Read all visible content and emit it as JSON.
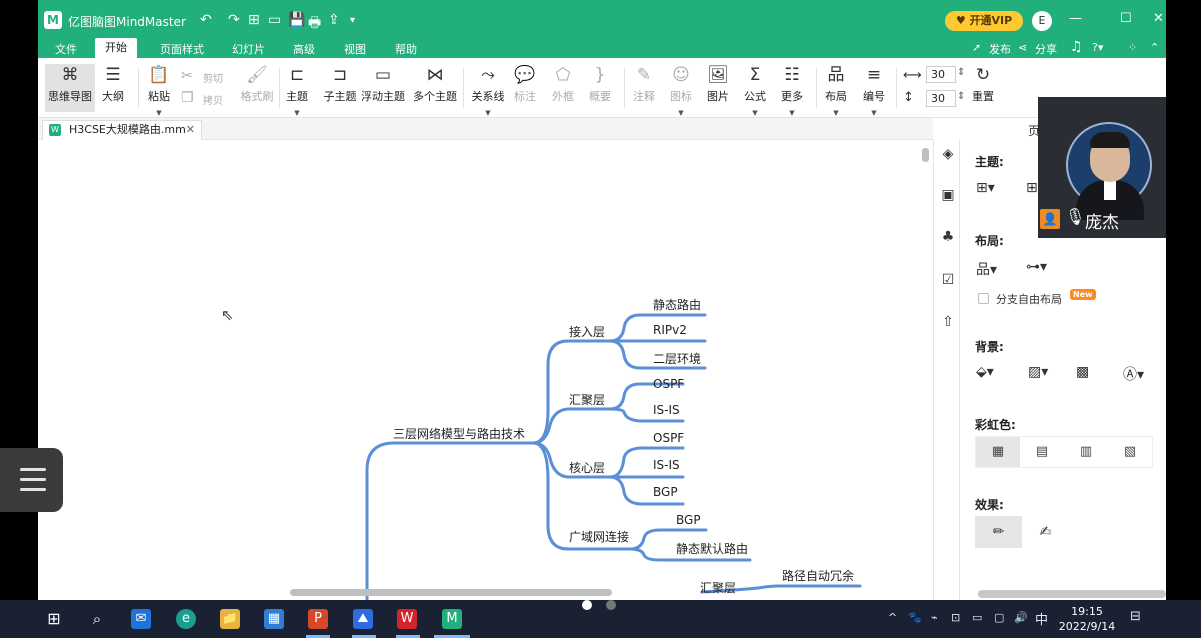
{
  "app": {
    "title": "亿图脑图MindMaster",
    "logo_glyph": "M",
    "vip_label": "开通VIP",
    "user_initial": "E",
    "minimize": "—",
    "maximize": "☐",
    "close": "✕",
    "quick_access": [
      "↶",
      "↷",
      "⊞",
      "▭",
      "💾",
      "🖶",
      "⇪",
      "▾"
    ]
  },
  "menu": {
    "items": [
      "文件",
      "开始",
      "页面样式",
      "幻灯片",
      "高级",
      "视图",
      "帮助"
    ],
    "active": "开始",
    "right": {
      "publish": "发布",
      "share": "分享"
    }
  },
  "ribbon": {
    "buttons": [
      {
        "label": "思维导图",
        "icon": "⌘"
      },
      {
        "label": "大纲",
        "icon": "☰"
      },
      {
        "label": "粘贴",
        "icon": "📋"
      },
      {
        "label": "主题",
        "icon": "⊏"
      },
      {
        "label": "子主题",
        "icon": "⊐"
      },
      {
        "label": "浮动主题",
        "icon": "▭"
      },
      {
        "label": "多个主题",
        "icon": "⋈"
      },
      {
        "label": "关系线",
        "icon": "⤳"
      },
      {
        "label": "标注",
        "icon": "💬"
      },
      {
        "label": "外框",
        "icon": "⬠"
      },
      {
        "label": "概要",
        "icon": "}"
      },
      {
        "label": "注释",
        "icon": "✎"
      },
      {
        "label": "图标",
        "icon": "☺"
      },
      {
        "label": "图片",
        "icon": "🖼"
      },
      {
        "label": "公式",
        "icon": "Σ"
      },
      {
        "label": "更多",
        "icon": "☷"
      },
      {
        "label": "布局",
        "icon": "品"
      },
      {
        "label": "编号",
        "icon": "≡"
      },
      {
        "label": "重置",
        "icon": "↻"
      }
    ],
    "small": {
      "cut": "剪切",
      "copy": "拷贝",
      "format_painter": "格式刷"
    },
    "spin_h": "30",
    "spin_v": "30"
  },
  "tab": {
    "filename": "H3CSE大规模路由.mm",
    "file_icon": "W",
    "close": "✕"
  },
  "mindmap": {
    "root": "三层网络模型与路由技术",
    "layers": [
      {
        "name": "接入层",
        "children": [
          "静态路由",
          "RIPv2",
          "二层环境"
        ]
      },
      {
        "name": "汇聚层",
        "children": [
          "OSPF",
          "IS-IS"
        ]
      },
      {
        "name": "核心层",
        "children": [
          "OSPF",
          "IS-IS",
          "BGP"
        ]
      },
      {
        "name": "广域网连接",
        "children": [
          "BGP",
          "静态默认路由"
        ]
      }
    ],
    "partial": {
      "branch": "汇聚层",
      "child": "路径自动冗余"
    },
    "line_color": "#5b8fd6"
  },
  "panel": {
    "title": "页",
    "theme_label": "主题:",
    "layout_label": "布局:",
    "free_layout": "分支自由布局",
    "new_badge": "New",
    "background_label": "背景:",
    "rainbow_label": "彩虹色:",
    "effect_label": "效果:"
  },
  "webcam": {
    "name": "庞杰"
  },
  "taskbar": {
    "icons": [
      "⊞",
      "⌕",
      "✉",
      "e",
      "📁",
      "▦",
      "P",
      "⛰",
      "W",
      "M"
    ],
    "tray": [
      "^",
      "🐾",
      "⌁",
      "⊡",
      "▭",
      "▢",
      "🔊",
      "中",
      "⊟"
    ],
    "time": "19:15",
    "date": "2022/9/14"
  },
  "colors": {
    "brand": "#21b07b",
    "vip": "#ffc933",
    "taskbar": "#1a2133"
  }
}
